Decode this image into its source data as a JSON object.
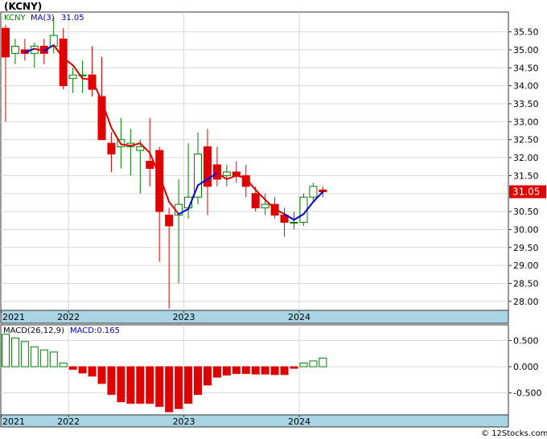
{
  "title": "(KCNY)",
  "watermark": "© 12Stocks.com",
  "colors": {
    "down": "#e00000",
    "up": "#008000",
    "ma_up": "#0000e0",
    "ma_down": "#e00000",
    "axis_strip": "#a8d4e4",
    "last_price_box": "#e00000",
    "legend_ticker": "#008000",
    "legend_ma": "#0000cc"
  },
  "chart_data": [
    {
      "type": "candlestick",
      "name": "price",
      "legend": {
        "ticker": "KCNY",
        "ma_label": "MA(3)",
        "ma_value": "31.05"
      },
      "last_price_label": "31.05",
      "last_price": 31.05,
      "ylim": [
        27.75,
        36.05
      ],
      "y_ticks": [
        28.0,
        28.5,
        29.0,
        29.5,
        30.0,
        30.5,
        31.0,
        31.5,
        32.0,
        32.5,
        33.0,
        33.5,
        34.0,
        34.5,
        35.0,
        35.5
      ],
      "y_tick_labels": [
        "28.00",
        "28.50",
        "29.00",
        "29.50",
        "30.00",
        "30.50",
        "31.00",
        "31.50",
        "32.00",
        "32.50",
        "33.00",
        "33.50",
        "34.00",
        "34.50",
        "35.00",
        "35.50"
      ],
      "x_labels": [
        {
          "label": "2021",
          "index": 0
        },
        {
          "label": "2022",
          "index": 7
        },
        {
          "label": "2023",
          "index": 19
        },
        {
          "label": "2024",
          "index": 31
        }
      ],
      "candles": [
        {
          "o": 35.6,
          "h": 35.7,
          "l": 33.0,
          "c": 34.8
        },
        {
          "o": 34.9,
          "h": 35.3,
          "l": 34.6,
          "c": 35.1
        },
        {
          "o": 35.0,
          "h": 35.3,
          "l": 34.7,
          "c": 34.9
        },
        {
          "o": 34.9,
          "h": 35.2,
          "l": 34.5,
          "c": 35.1
        },
        {
          "o": 35.1,
          "h": 35.3,
          "l": 34.6,
          "c": 34.9
        },
        {
          "o": 35.1,
          "h": 35.9,
          "l": 34.9,
          "c": 35.4
        },
        {
          "o": 35.3,
          "h": 35.6,
          "l": 33.9,
          "c": 34.0
        },
        {
          "o": 34.2,
          "h": 34.5,
          "l": 33.8,
          "c": 34.3
        },
        {
          "o": 34.3,
          "h": 34.7,
          "l": 33.8,
          "c": 34.3
        },
        {
          "o": 34.3,
          "h": 35.1,
          "l": 33.7,
          "c": 33.9
        },
        {
          "o": 33.7,
          "h": 34.8,
          "l": 33.1,
          "c": 32.5
        },
        {
          "o": 32.4,
          "h": 32.7,
          "l": 31.6,
          "c": 32.1
        },
        {
          "o": 32.3,
          "h": 33.1,
          "l": 31.7,
          "c": 32.5
        },
        {
          "o": 32.3,
          "h": 32.8,
          "l": 31.5,
          "c": 32.4
        },
        {
          "o": 32.2,
          "h": 32.5,
          "l": 31.0,
          "c": 32.3
        },
        {
          "o": 31.9,
          "h": 33.1,
          "l": 31.2,
          "c": 31.7
        },
        {
          "o": 32.2,
          "h": 32.3,
          "l": 29.1,
          "c": 30.5
        },
        {
          "o": 30.4,
          "h": 30.6,
          "l": 27.8,
          "c": 30.1
        },
        {
          "o": 30.4,
          "h": 31.4,
          "l": 28.5,
          "c": 30.7
        },
        {
          "o": 30.6,
          "h": 32.4,
          "l": 30.3,
          "c": 30.9
        },
        {
          "o": 30.9,
          "h": 32.7,
          "l": 30.7,
          "c": 32.1
        },
        {
          "o": 32.3,
          "h": 32.8,
          "l": 30.4,
          "c": 31.2
        },
        {
          "o": 31.8,
          "h": 32.3,
          "l": 31.2,
          "c": 31.4
        },
        {
          "o": 31.5,
          "h": 31.8,
          "l": 31.2,
          "c": 31.6
        },
        {
          "o": 31.6,
          "h": 31.9,
          "l": 31.3,
          "c": 31.5
        },
        {
          "o": 31.5,
          "h": 31.8,
          "l": 30.9,
          "c": 31.2
        },
        {
          "o": 31.0,
          "h": 31.2,
          "l": 30.5,
          "c": 30.6
        },
        {
          "o": 30.6,
          "h": 31.0,
          "l": 30.4,
          "c": 30.7
        },
        {
          "o": 30.7,
          "h": 30.9,
          "l": 30.3,
          "c": 30.4
        },
        {
          "o": 30.4,
          "h": 30.6,
          "l": 29.8,
          "c": 30.2
        },
        {
          "o": 30.2,
          "h": 30.5,
          "l": 30.0,
          "c": 30.2
        },
        {
          "o": 30.2,
          "h": 31.0,
          "l": 30.1,
          "c": 30.9
        },
        {
          "o": 30.9,
          "h": 31.3,
          "l": 30.8,
          "c": 31.2
        },
        {
          "o": 31.1,
          "h": 31.2,
          "l": 30.9,
          "c": 31.05
        }
      ],
      "ma": [
        null,
        null,
        34.93,
        35.03,
        34.97,
        35.13,
        34.77,
        34.57,
        34.2,
        34.17,
        33.57,
        32.83,
        32.37,
        32.33,
        32.4,
        32.13,
        31.5,
        30.77,
        30.43,
        30.57,
        31.23,
        31.4,
        31.57,
        31.4,
        31.5,
        31.43,
        31.1,
        30.83,
        30.57,
        30.43,
        30.27,
        30.43,
        30.77,
        31.05
      ],
      "ma_trend": [
        "",
        "",
        "down",
        "up",
        "down",
        "up",
        "down",
        "down",
        "down",
        "down",
        "down",
        "down",
        "down",
        "down",
        "down",
        "down",
        "down",
        "down",
        "down",
        "up",
        "up",
        "up",
        "up",
        "down",
        "down",
        "down",
        "down",
        "down",
        "down",
        "down",
        "up",
        "up",
        "up",
        "up"
      ]
    },
    {
      "type": "bar",
      "name": "macd",
      "legend": {
        "label": "MACD(26,12,9)",
        "value_label": "MACD:0.165"
      },
      "ylim": [
        -0.92,
        0.8
      ],
      "y_ticks": [
        0.5,
        0.0,
        -0.5
      ],
      "y_tick_labels": [
        "0.500",
        "0.000",
        "-0.500"
      ],
      "x_labels": [
        {
          "label": "2021",
          "index": 0
        },
        {
          "label": "2022",
          "index": 7
        },
        {
          "label": "2023",
          "index": 19
        },
        {
          "label": "2024",
          "index": 31
        }
      ],
      "values": [
        0.62,
        0.55,
        0.48,
        0.38,
        0.32,
        0.28,
        0.07,
        -0.05,
        -0.12,
        -0.18,
        -0.32,
        -0.53,
        -0.67,
        -0.7,
        -0.7,
        -0.7,
        -0.76,
        -0.86,
        -0.8,
        -0.7,
        -0.53,
        -0.35,
        -0.2,
        -0.16,
        -0.13,
        -0.13,
        -0.14,
        -0.14,
        -0.15,
        -0.15,
        -0.03,
        0.07,
        0.11,
        0.165
      ]
    }
  ]
}
